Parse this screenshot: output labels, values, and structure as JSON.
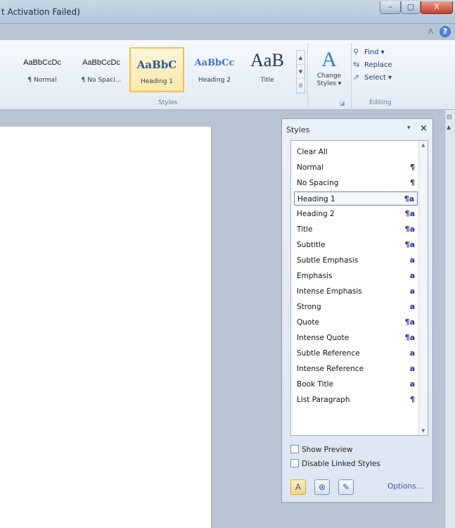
{
  "window": {
    "title": "t Activation Failed)",
    "minimize_glyph": "–",
    "maximize_glyph": "▢",
    "close_glyph": "X",
    "help_glyph": "?",
    "ribbon_toggle_glyph": "ᐱ"
  },
  "ribbon": {
    "styles_group_label": "Styles",
    "editing_group_label": "Editing",
    "style_gallery": [
      {
        "sample": "AaBbCcDc",
        "name": "¶ Normal"
      },
      {
        "sample": "AaBbCcDc",
        "name": "¶ No Spaci..."
      },
      {
        "sample": "AaBbC",
        "name": "Heading 1"
      },
      {
        "sample": "AaBbCc",
        "name": "Heading 2"
      },
      {
        "sample": "AaB",
        "name": "Title"
      }
    ],
    "change_styles": {
      "icon_glyph": "A",
      "line1": "Change",
      "line2": "Styles ▾"
    },
    "editing": {
      "find": "Find ▾",
      "replace": "Replace",
      "select": "Select ▾"
    }
  },
  "styles_pane": {
    "title": "Styles",
    "dropdown_glyph": "▾",
    "close_glyph": "×",
    "styles": [
      {
        "name": "Clear All",
        "mark": ""
      },
      {
        "name": "Normal",
        "mark": "¶"
      },
      {
        "name": "No Spacing",
        "mark": "¶"
      },
      {
        "name": "Heading 1",
        "mark": "¶a"
      },
      {
        "name": "Heading 2",
        "mark": "¶a"
      },
      {
        "name": "Title",
        "mark": "¶a"
      },
      {
        "name": "Subtitle",
        "mark": "¶a"
      },
      {
        "name": "Subtle Emphasis",
        "mark": "a"
      },
      {
        "name": "Emphasis",
        "mark": "a"
      },
      {
        "name": "Intense Emphasis",
        "mark": "a"
      },
      {
        "name": "Strong",
        "mark": "a"
      },
      {
        "name": "Quote",
        "mark": "¶a"
      },
      {
        "name": "Intense Quote",
        "mark": "¶a"
      },
      {
        "name": "Subtle Reference",
        "mark": "a"
      },
      {
        "name": "Intense Reference",
        "mark": "a"
      },
      {
        "name": "Book Title",
        "mark": "a"
      },
      {
        "name": "List Paragraph",
        "mark": "¶"
      }
    ],
    "selected_style": "Heading 1",
    "show_preview_label": "Show Preview",
    "disable_linked_label": "Disable Linked Styles",
    "options_label": "Options..."
  }
}
